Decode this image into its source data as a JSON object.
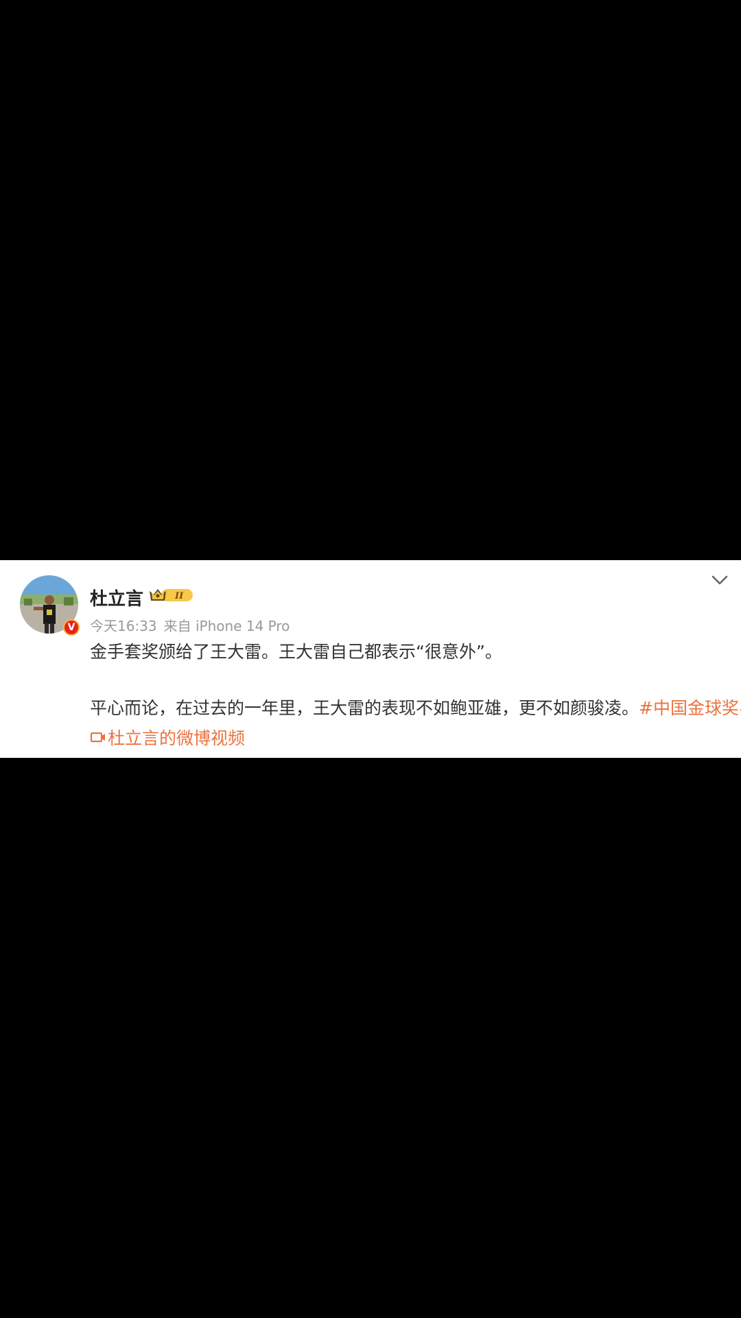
{
  "post": {
    "author": "杜立言",
    "badge_level": "II",
    "verified_mark": "V",
    "time": "今天16:33",
    "source": "来自 iPhone 14 Pro",
    "line1": "金手套奖颁给了王大雷。王大雷自己都表示“很意外”。",
    "line2": "平心而论，在过去的一年里，王大雷的表现不如鲍亚雄，更不如颜骏凌。",
    "hashtag": "#中国金球奖#",
    "video_link": "杜立言的微博视频",
    "icons": {
      "menu": "chevron-down-icon",
      "badge": "crown-badge-icon",
      "verified": "verified-icon",
      "video": "video-icon"
    }
  },
  "colors": {
    "background": "#000000",
    "card": "#ffffff",
    "link": "#eb7340",
    "meta": "#999999"
  }
}
